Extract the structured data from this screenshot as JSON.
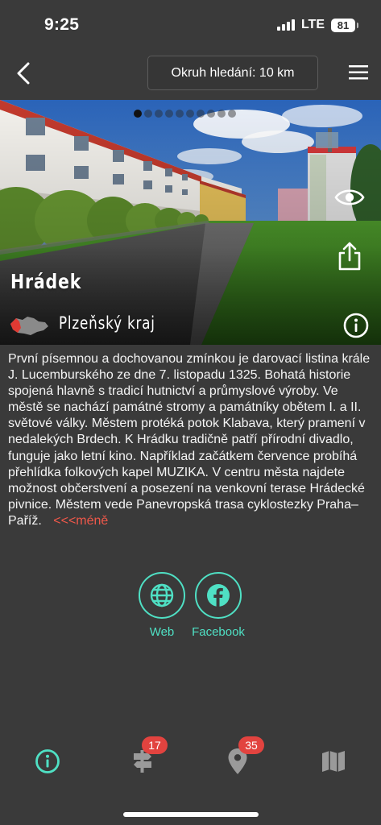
{
  "status_bar": {
    "time": "9:25",
    "network": "LTE",
    "battery": "81"
  },
  "header": {
    "radius_label": "Okruh hledání: 10 km"
  },
  "hero": {
    "place_name": "Hrádek",
    "region": "Plzeňský kraj",
    "slides_total": 10,
    "active_slide": 1
  },
  "description": {
    "text": "První písemnou a dochovanou zmínkou je darovací listina krále J. Lucemburského ze dne 7. listopadu 1325. Bohatá historie spojená hlavně s tradicí hutnictví a průmyslové výroby. Ve městě se nachází památné stromy a památníky obětem I. a II. světové války. Městem protéká potok Klabava, který pramení v nedalekých Brdech. K Hrádku tradičně patří přírodní divadlo, funguje jako letní kino. Například začátkem července probíhá přehlídka folkových kapel MUZIKA. V centru města najdete možnost občerstvení a posezení na venkovní terase Hrádecké pivnice. Městem vede Panevropská trasa cyklostezky Praha–Paříž.",
    "less_label": "<<<méně"
  },
  "links": {
    "web_label": "Web",
    "facebook_label": "Facebook"
  },
  "bottom_nav": {
    "signpost_badge": "17",
    "places_badge": "35"
  },
  "colors": {
    "accent": "#4fe0c4",
    "badge": "#e2433f",
    "background": "#3a3a3a",
    "less_link": "#f0584a"
  },
  "icons": [
    "chevron-left-icon",
    "hamburger-menu-icon",
    "eye-icon",
    "share-icon",
    "info-icon",
    "globe-icon",
    "facebook-icon",
    "signpost-icon",
    "map-pin-icon",
    "map-icon"
  ]
}
